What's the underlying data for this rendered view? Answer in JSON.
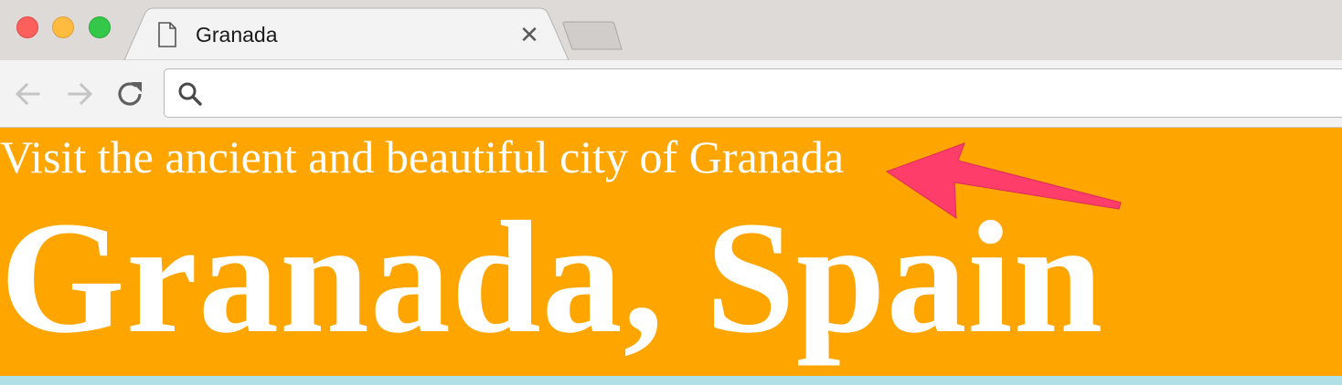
{
  "window": {
    "tab": {
      "title": "Granada",
      "icon": "page-icon",
      "close_glyph": "✕"
    }
  },
  "toolbar": {
    "icons": [
      "back-arrow-icon",
      "forward-arrow-icon",
      "reload-icon",
      "search-icon"
    ],
    "omnibox": {
      "value": "",
      "placeholder": ""
    }
  },
  "page": {
    "subtitle": "Visit the ancient and beautiful city of Granada",
    "headline": "Granada, Spain"
  },
  "colors": {
    "header_background": "#ffa500",
    "header_text": "#ffffff",
    "strip_background": "#b0e0e6",
    "annotation_arrow": "#ff3d6b"
  }
}
